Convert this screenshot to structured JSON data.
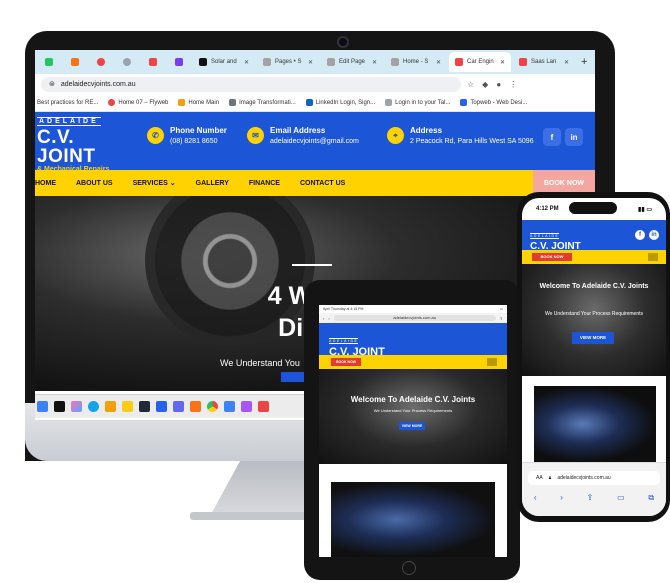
{
  "browser": {
    "tabs": [
      {
        "label": "Solar and"
      },
      {
        "label": "Pages • S"
      },
      {
        "label": "Edit Page"
      },
      {
        "label": "Home - S"
      },
      {
        "label": "Car Engin"
      },
      {
        "label": "Saas Lan"
      }
    ],
    "url": "adelaidecvjoints.com.au",
    "bookmarks": [
      {
        "label": "Best practices for RE..."
      },
      {
        "label": "Home 07 – Flyweb"
      },
      {
        "label": "Home Main"
      },
      {
        "label": "Image Transformati..."
      },
      {
        "label": "LinkedIn Login, Sign..."
      },
      {
        "label": "Login in to your Tal..."
      },
      {
        "label": "Topweb - Web Desi..."
      }
    ]
  },
  "site": {
    "logo_top": "ADELAIDE",
    "logo_main": "C.V. JOINT",
    "logo_sub": "& Mechanical Repairs",
    "phone_label": "Phone Number",
    "phone_value": "(08) 8281 8650",
    "email_label": "Email Address",
    "email_value": "adelaidecvjoints@gmail.com",
    "address_label": "Address",
    "address_value": "2 Peacock Rd, Para Hills West SA 5096",
    "nav": [
      "HOME",
      "ABOUT US",
      "SERVICES",
      "GALLERY",
      "FINANCE",
      "CONTACT US"
    ],
    "book_now": "BOOK NOW",
    "hero_title_line1": "4 Wheel",
    "hero_title_line2": "Diesel",
    "hero_sub": "We Understand You"
  },
  "tablet": {
    "status_time": "April Thursday at 4:15 PM",
    "url": "adelaidecvjoints.com.au",
    "hero_title": "Welcome To Adelaide C.V. Joints",
    "hero_sub": "We Understand Your Process Requirements",
    "view_more": "VIEW MORE",
    "book_now": "BOOK NOW"
  },
  "phone": {
    "time": "4:12 PM",
    "hero_title": "Welcome To Adelaide C.V. Joints",
    "hero_sub": "We Understand Your Process Requirements",
    "view_more": "VIEW MORE",
    "book_now": "BOOK NOW",
    "aa": "AA",
    "url": "adelaidecvjoints.com.au"
  },
  "colors": {
    "brand_blue": "#1c55d6",
    "brand_yellow": "#ffd200",
    "book_red": "#e23b2f"
  }
}
